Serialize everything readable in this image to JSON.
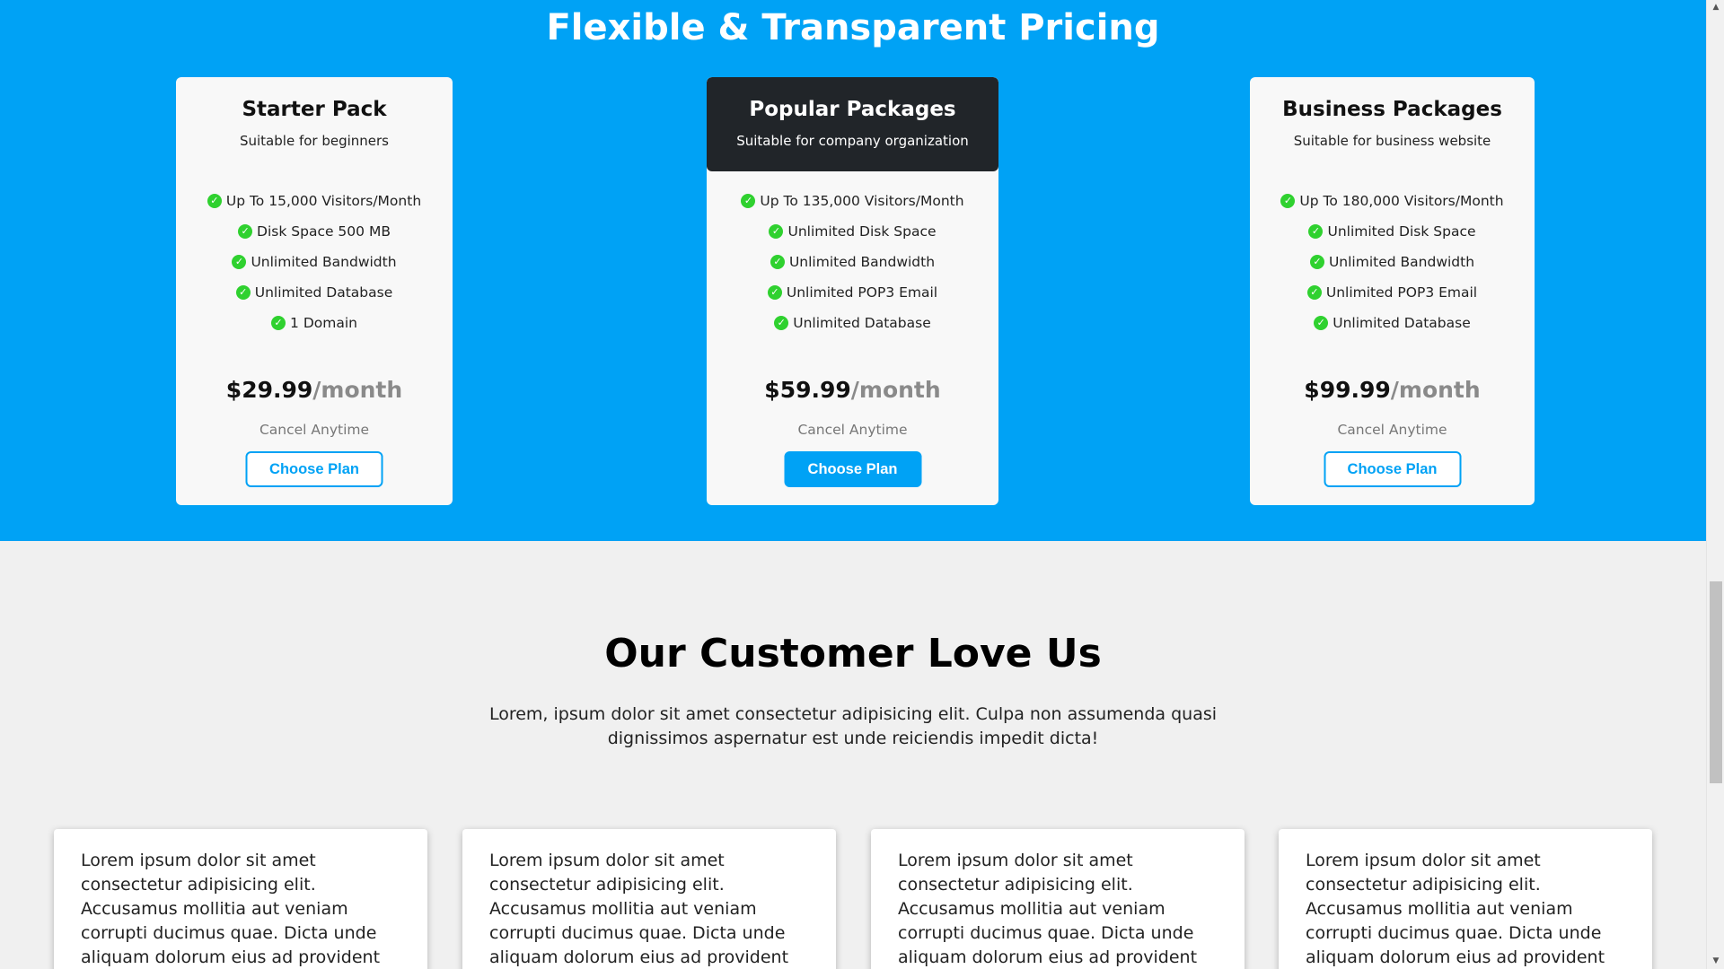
{
  "pricing": {
    "title": "Flexible & Transparent Pricing",
    "plans": [
      {
        "name": "Starter Pack",
        "subtitle": "Suitable for beginners",
        "features": [
          "Up To 15,000 Visitors/Month",
          "Disk Space 500 MB",
          "Unlimited Bandwidth",
          "Unlimited Database",
          "1 Domain"
        ],
        "price": "$29.99",
        "period": "/month",
        "cancel": "Cancel Anytime",
        "button": "Choose Plan"
      },
      {
        "name": "Popular Packages",
        "subtitle": "Suitable for company organization",
        "features": [
          "Up To 135,000 Visitors/Month",
          "Unlimited Disk Space",
          "Unlimited Bandwidth",
          "Unlimited POP3 Email",
          "Unlimited Database"
        ],
        "price": "$59.99",
        "period": "/month",
        "cancel": "Cancel Anytime",
        "button": "Choose Plan"
      },
      {
        "name": "Business Packages",
        "subtitle": "Suitable for business website",
        "features": [
          "Up To 180,000 Visitors/Month",
          "Unlimited Disk Space",
          "Unlimited Bandwidth",
          "Unlimited POP3 Email",
          "Unlimited Database"
        ],
        "price": "$99.99",
        "period": "/month",
        "cancel": "Cancel Anytime",
        "button": "Choose Plan"
      }
    ]
  },
  "testimonials": {
    "title": "Our Customer Love Us",
    "description": "Lorem, ipsum dolor sit amet consectetur adipisicing elit. Culpa non assumenda quasi dignissimos aspernatur est unde reiciendis impedit dicta!",
    "items": [
      {
        "text": "Lorem ipsum dolor sit amet consectetur adipisicing elit. Accusamus mollitia aut veniam corrupti ducimus quae. Dicta unde aliquam dolorum eius ad provident culpa nulla iure."
      },
      {
        "text": "Lorem ipsum dolor sit amet consectetur adipisicing elit. Accusamus mollitia aut veniam corrupti ducimus quae. Dicta unde aliquam dolorum eius ad provident culpa nulla iure."
      },
      {
        "text": "Lorem ipsum dolor sit amet consectetur adipisicing elit. Accusamus mollitia aut veniam corrupti ducimus quae. Dicta unde aliquam dolorum eius ad provident culpa nulla iure."
      },
      {
        "text": "Lorem ipsum dolor sit amet consectetur adipisicing elit. Accusamus mollitia aut veniam corrupti ducimus quae. Dicta unde aliquam dolorum eius ad provident culpa nulla iure."
      }
    ]
  },
  "icons": {
    "feature_check": "check-circle-icon",
    "scroll_up": "scroll-up-arrow-icon",
    "scroll_down": "scroll-down-arrow-icon"
  },
  "colors": {
    "accent": "#00a2f5",
    "featured_header": "#212529",
    "check": "#2fd12f",
    "background": "#f0f0f0"
  }
}
